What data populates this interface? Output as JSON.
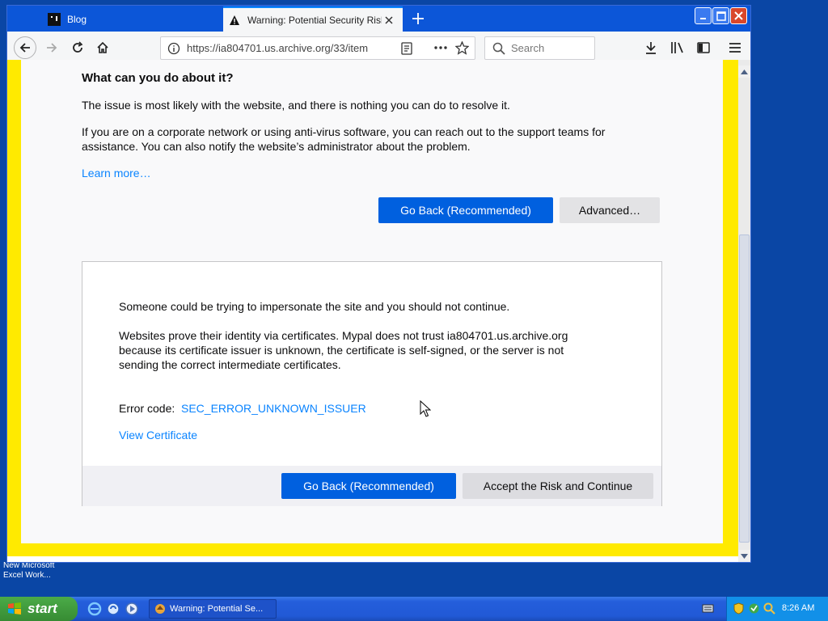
{
  "browser": {
    "tabs": [
      {
        "title": "Blog",
        "active": false
      },
      {
        "title": "Warning: Potential Security Risk Ah",
        "active": true
      }
    ],
    "url": "https://ia804701.us.archive.org/33/item",
    "search_placeholder": "Search"
  },
  "page": {
    "heading": "What can you do about it?",
    "para1": "The issue is most likely with the website, and there is nothing you can do to resolve it.",
    "para2_line1": "If you are on a corporate network or using anti-virus software, you can reach out to the support teams for",
    "para2_line2": "assistance. You can also notify the website’s administrator about the problem.",
    "learn_more": "Learn more…",
    "go_back_button": "Go Back (Recommended)",
    "advanced_button": "Advanced…",
    "advanced": {
      "line1": "Someone could be trying to impersonate the site and you should not continue.",
      "line2": "Websites prove their identity via certificates. Mypal does not trust ia804701.us.archive.org",
      "line3": "because its certificate issuer is unknown, the certificate is self-signed, or the server is not",
      "line4": "sending the correct intermediate certificates.",
      "error_label": "Error code:",
      "error_code": "SEC_ERROR_UNKNOWN_ISSUER",
      "view_certificate": "View Certificate",
      "go_back_button": "Go Back (Recommended)",
      "accept_button": "Accept the Risk and Continue"
    }
  },
  "desktop": {
    "icon_label_line1": "New Microsoft",
    "icon_label_line2": "Excel Work..."
  },
  "taskbar": {
    "start_label": "start",
    "task_item": "Warning: Potential Se...",
    "clock": "8:26 AM"
  },
  "colors": {
    "primary_button": "#0060df",
    "link": "#0a84ff",
    "page_border": "#ffea00"
  }
}
